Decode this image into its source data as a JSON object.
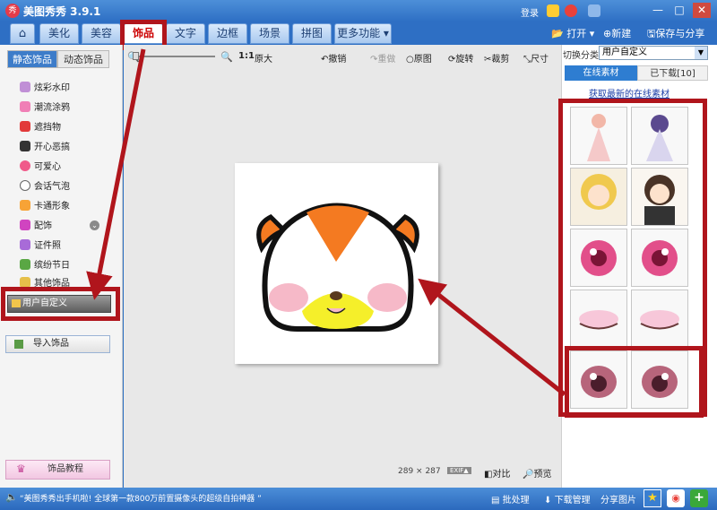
{
  "app": {
    "title": "美图秀秀 3.9.1",
    "logo_text": "秀",
    "login": "登录"
  },
  "window_controls": [
    "—",
    "□",
    "✕"
  ],
  "menu": {
    "tabs": [
      "美化",
      "美容",
      "饰品",
      "文字",
      "边框",
      "场景",
      "拼图",
      "更多功能"
    ],
    "open": "打开",
    "new": "新建",
    "save": "保存与分享"
  },
  "left": {
    "tabs": [
      "静态饰品",
      "动态饰品"
    ],
    "categories": [
      "炫彩水印",
      "潮流涂鸦",
      "遮挡物",
      "开心恶搞",
      "可爱心",
      "会话气泡",
      "卡通形象",
      "配饰",
      "证件照",
      "缤纷节日",
      "其他饰品"
    ],
    "user_defined": "用户自定义",
    "import": "导入饰品",
    "tutorial": "饰品教程"
  },
  "toolbar": {
    "zoom_ratio": "1:1",
    "original_size": "原大",
    "undo": "撤销",
    "redo": "重做",
    "original": "原图",
    "rotate": "旋转",
    "crop": "裁剪",
    "size": "尺寸"
  },
  "canvas_footer": {
    "dimensions": "289 × 287",
    "exif": "EXIF▲",
    "compare": "对比",
    "preview": "预览"
  },
  "right": {
    "switch_label": "切换分类",
    "category": "用户自定义",
    "tabs": [
      "在线素材",
      "已下载[10]"
    ],
    "get_more": "获取最新的在线素材",
    "thumb_count": 10
  },
  "status": {
    "message": "“美图秀秀出手机啦! 全球第一款800万前置摄像头的超级自拍神器 ”",
    "batch": "批处理",
    "download": "下载管理",
    "share": "分享图片"
  },
  "colors": {
    "accent_red": "#b0151c",
    "title_blue": "#2e6fc4"
  }
}
